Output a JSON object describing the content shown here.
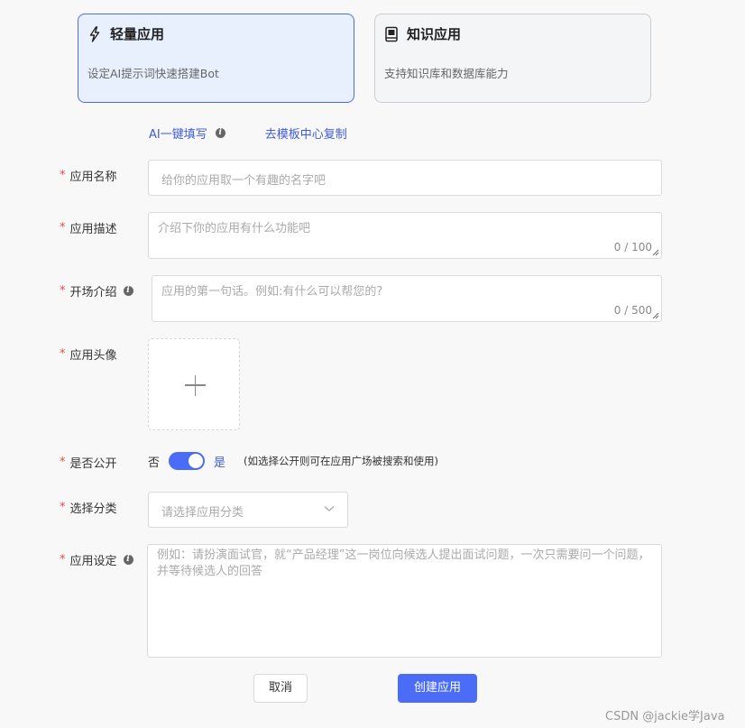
{
  "cards": [
    {
      "title": "轻量应用",
      "desc": "设定AI提示词快速搭建Bot",
      "icon": "lightning-icon",
      "selected": true
    },
    {
      "title": "知识应用",
      "desc": "支持知识库和数据库能力",
      "icon": "book-icon",
      "selected": false
    }
  ],
  "links": {
    "ai_fill": "AI一键填写",
    "template_copy": "去模板中心复制"
  },
  "form": {
    "name": {
      "label": "应用名称",
      "placeholder": "给你的应用取一个有趣的名字吧"
    },
    "desc": {
      "label": "应用描述",
      "placeholder": "介绍下你的应用有什么功能吧",
      "counter": "0 / 100"
    },
    "intro": {
      "label": "开场介绍",
      "placeholder": "应用的第一句话。例如:有什么可以帮您的?",
      "counter": "0 / 500"
    },
    "avatar": {
      "label": "应用头像"
    },
    "public": {
      "label": "是否公开",
      "off_label": "否",
      "on_label": "是",
      "hint": "(如选择公开则可在应用广场被搜索和使用)",
      "value": true
    },
    "category": {
      "label": "选择分类",
      "placeholder": "请选择应用分类"
    },
    "setting": {
      "label": "应用设定",
      "placeholder": "例如：请扮演面试官，就“产品经理”这一岗位向候选人提出面试问题，一次只需要问一个问题，并等待候选人的回答"
    }
  },
  "buttons": {
    "cancel": "取消",
    "create": "创建应用"
  },
  "watermark": "CSDN @jackie学Java",
  "colors": {
    "accent": "#4a6cf7",
    "required": "#e34d4d"
  }
}
